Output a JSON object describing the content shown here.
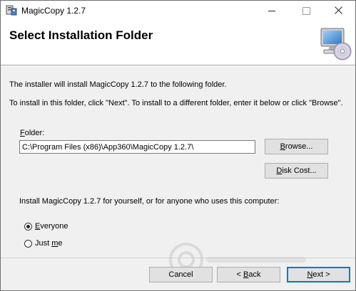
{
  "window": {
    "title": "MagicCopy 1.2.7",
    "controls": {
      "minimize": "minimize",
      "maximize": "maximize",
      "close": "close"
    }
  },
  "banner": {
    "title": "Select Installation Folder"
  },
  "body": {
    "intro": "The installer will install MagicCopy 1.2.7 to the following folder.",
    "instructions": "To install in this folder, click \"Next\". To install to a different folder, enter it below or click \"Browse\".",
    "folder_label_underlined": "F",
    "folder_label_rest": "older:",
    "folder_value": "C:\\Program Files (x86)\\App360\\MagicCopy 1.2.7\\",
    "browse_underlined": "B",
    "browse_rest": "rowse...",
    "diskcost_underlined": "D",
    "diskcost_rest": "isk Cost...",
    "install_for": "Install MagicCopy 1.2.7 for yourself, or for anyone who uses this computer:",
    "radio_everyone_underlined": "E",
    "radio_everyone_rest": "veryone",
    "radio_justme_pre": "Just ",
    "radio_justme_underlined": "m",
    "radio_justme_post": "e",
    "selected_option": "everyone"
  },
  "footer": {
    "cancel": "Cancel",
    "back_pre": "< ",
    "back_underlined": "B",
    "back_post": "ack",
    "next_underlined": "N",
    "next_post": "ext >"
  },
  "colors": {
    "accent": "#0078d7",
    "button_face": "#e1e1e1",
    "window_bg": "#f0f0f0"
  },
  "icons": [
    "installer-app-icon",
    "computer-cd-icon",
    "close-icon"
  ]
}
